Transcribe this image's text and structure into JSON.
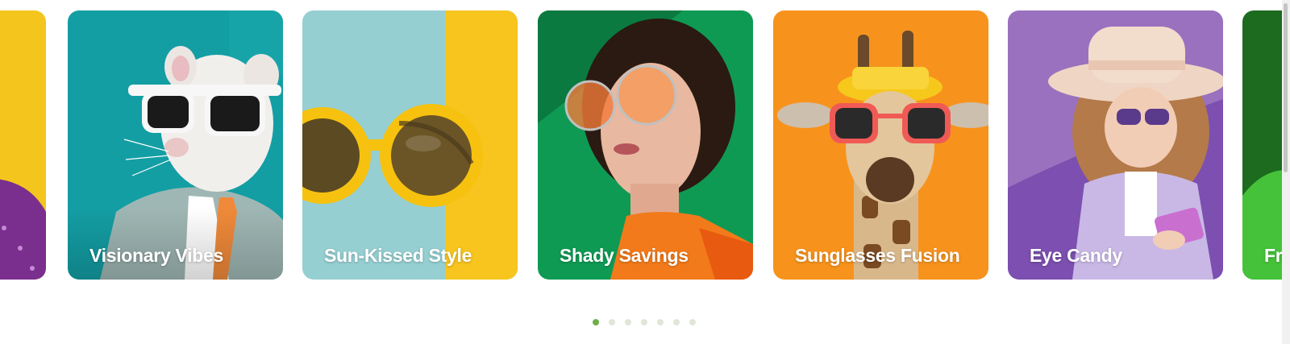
{
  "carousel": {
    "cards": [
      {
        "label": "",
        "bg": "#f4c51c"
      },
      {
        "label": "Visionary Vibes",
        "bg": "#139ea4"
      },
      {
        "label": "Sun-Kissed Style",
        "bg": "#96cfd2"
      },
      {
        "label": "Shady Savings",
        "bg": "#0f9a54"
      },
      {
        "label": "Sunglasses Fusion",
        "bg": "#f7931c"
      },
      {
        "label": "Eye Candy",
        "bg": "#9a71bf"
      },
      {
        "label": "Fra",
        "bg": "#1c6b1f"
      }
    ],
    "pagination": {
      "count": 7,
      "active_index": 0,
      "active_color": "#6fae46",
      "inactive_color": "#dfe6d8"
    }
  }
}
